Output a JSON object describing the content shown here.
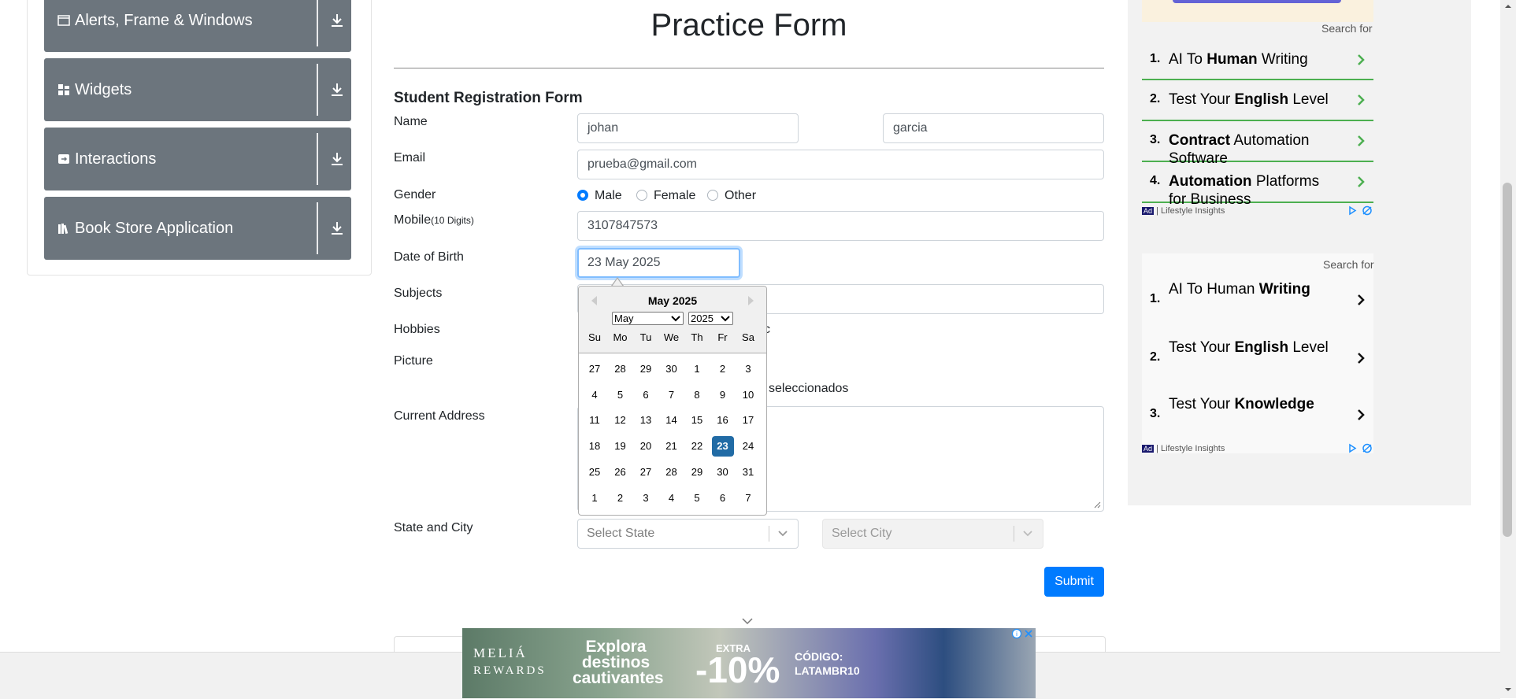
{
  "sidebar": {
    "groups": [
      {
        "label": "Alerts, Frame & Windows",
        "icon": "window-icon"
      },
      {
        "label": "Widgets",
        "icon": "widgets-grid-icon"
      },
      {
        "label": "Interactions",
        "icon": "interactions-icon"
      },
      {
        "label": "Book Store Application",
        "icon": "books-icon"
      }
    ]
  },
  "form": {
    "title": "Practice Form",
    "subtitle": "Student Registration Form",
    "name_label": "Name",
    "first_name": "johan",
    "last_name": "garcia",
    "email_label": "Email",
    "email": "prueba@gmail.com",
    "gender_label": "Gender",
    "gender_options": [
      "Male",
      "Female",
      "Other"
    ],
    "gender_selected": "Male",
    "mobile_label": "Mobile",
    "mobile_hint": "(10 Digits)",
    "mobile": "3107847573",
    "dob_label": "Date of Birth",
    "dob": "23 May 2025",
    "subjects_label": "Subjects",
    "hobbies_label": "Hobbies",
    "hobbies_partial": "c",
    "picture_label": "Picture",
    "picture_status": "seleccionados",
    "address_label": "Current Address",
    "state_city_label": "State and City",
    "state_placeholder": "Select State",
    "city_placeholder": "Select City",
    "submit": "Submit"
  },
  "datepicker": {
    "header": "May 2025",
    "month_select": "May",
    "year_select": "2025",
    "weekdays": [
      "Su",
      "Mo",
      "Tu",
      "We",
      "Th",
      "Fr",
      "Sa"
    ],
    "weeks": [
      [
        "27",
        "28",
        "29",
        "30",
        "1",
        "2",
        "3"
      ],
      [
        "4",
        "5",
        "6",
        "7",
        "8",
        "9",
        "10"
      ],
      [
        "11",
        "12",
        "13",
        "14",
        "15",
        "16",
        "17"
      ],
      [
        "18",
        "19",
        "20",
        "21",
        "22",
        "23",
        "24"
      ],
      [
        "25",
        "26",
        "27",
        "28",
        "29",
        "30",
        "31"
      ],
      [
        "1",
        "2",
        "3",
        "4",
        "5",
        "6",
        "7"
      ]
    ],
    "selected_day": "23"
  },
  "ads": {
    "search_for": "Search for",
    "block1": [
      {
        "num": "1.",
        "pre": "AI To ",
        "bold": "Human",
        "post": " Writing"
      },
      {
        "num": "2.",
        "pre": "Test Your ",
        "bold": "English",
        "post": " Level"
      },
      {
        "num": "3.",
        "pre": "",
        "bold": "Contract",
        "post": " Automation Software"
      },
      {
        "num": "4.",
        "pre": "",
        "bold": "Automation",
        "post": " Platforms for Business"
      }
    ],
    "block2": [
      {
        "num": "1.",
        "pre": "AI To Human ",
        "bold": "Writing",
        "post": ""
      },
      {
        "num": "2.",
        "pre": "Test Your ",
        "bold": "English",
        "post": " Level"
      },
      {
        "num": "3.",
        "pre": "Test Your ",
        "bold": "Knowledge",
        "post": ""
      }
    ],
    "ad_badge": "Ad",
    "sponsor": "Lifestyle Insights",
    "banner": {
      "brand_line1": "MELIÁ",
      "brand_line2": "REWARDS",
      "headline1": "Explora",
      "headline2": "destinos",
      "headline3": "cautivantes",
      "extra": "EXTRA",
      "discount": "-10%",
      "code_label": "CÓDIGO:",
      "code": "LATAMBR10"
    }
  },
  "colors": {
    "sidebar_group": "#6c757d",
    "primary": "#007bff",
    "selected_day": "#216ba5",
    "ad_arrow": "#4caf50"
  }
}
